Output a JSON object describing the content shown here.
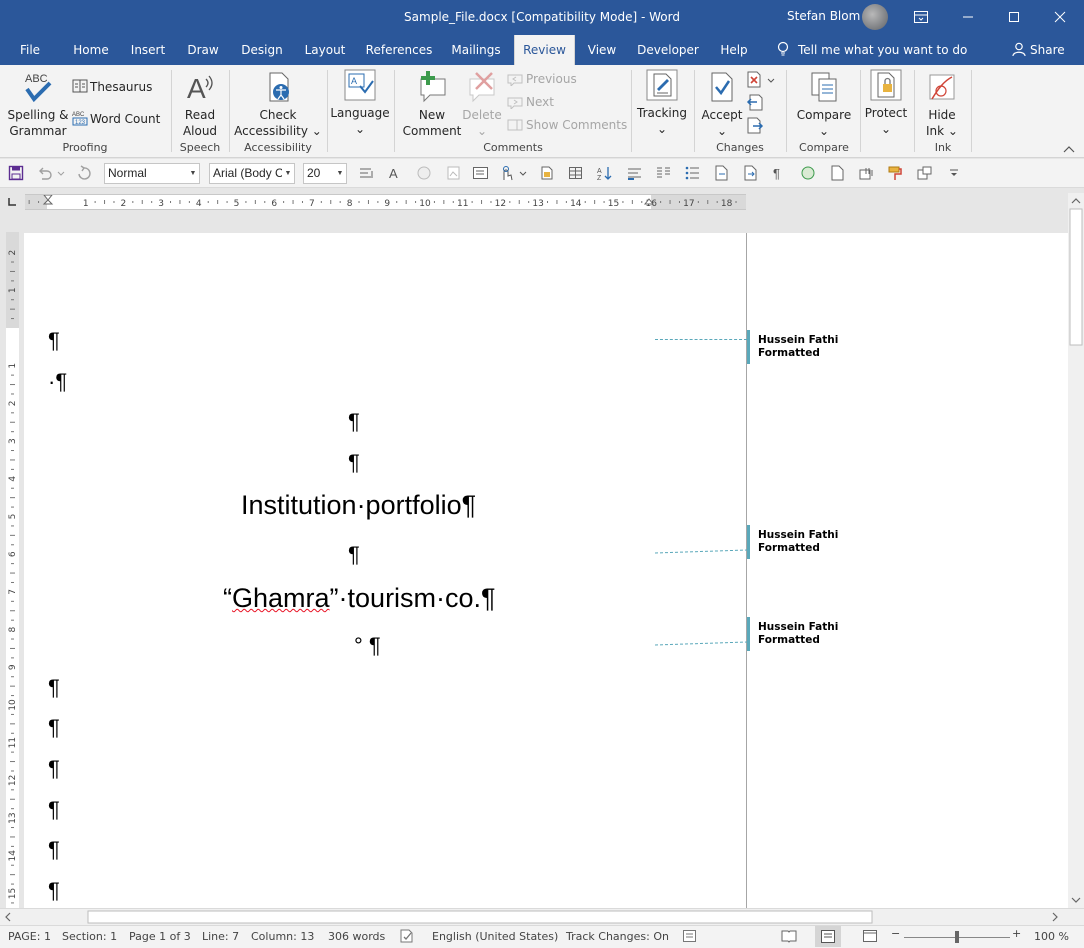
{
  "titlebar": {
    "title": "Sample_File.docx [Compatibility Mode]  -  Word",
    "user": "Stefan Blom",
    "window_buttons": [
      "ribbon-display-icon",
      "minimize-icon",
      "maximize-icon",
      "close-icon"
    ]
  },
  "tabs": [
    {
      "label": "File"
    },
    {
      "label": "Home"
    },
    {
      "label": "Insert"
    },
    {
      "label": "Draw"
    },
    {
      "label": "Design"
    },
    {
      "label": "Layout"
    },
    {
      "label": "References"
    },
    {
      "label": "Mailings"
    },
    {
      "label": "Review",
      "active": true
    },
    {
      "label": "View"
    },
    {
      "label": "Developer"
    },
    {
      "label": "Help"
    }
  ],
  "tellme": "Tell me what you want to do",
  "share": "Share",
  "ribbon": {
    "proofing": {
      "spelling_1": "Spelling &",
      "spelling_2": "Grammar",
      "thesaurus": "Thesaurus",
      "word_count": "Word Count",
      "label": "Proofing"
    },
    "speech": {
      "read_1": "Read",
      "read_2": "Aloud",
      "label": "Speech"
    },
    "accessibility": {
      "check_1": "Check",
      "check_2": "Accessibility ⌄",
      "label": "Accessibility"
    },
    "language": {
      "label_btn": "Language",
      "caret": "⌄"
    },
    "comments": {
      "new_1": "New",
      "new_2": "Comment",
      "delete_1": "Delete",
      "delete_2": "⌄",
      "previous": "Previous",
      "next": "Next",
      "show": "Show Comments",
      "label": "Comments"
    },
    "tracking": {
      "label_btn": "Tracking",
      "caret": "⌄"
    },
    "changes": {
      "accept": "Accept",
      "caret": "⌄",
      "label": "Changes"
    },
    "compare": {
      "label_btn": "Compare",
      "caret": "⌄",
      "label": "Compare"
    },
    "protect": {
      "label_btn": "Protect",
      "caret": "⌄"
    },
    "ink": {
      "hide_1": "Hide",
      "hide_2": "Ink ⌄",
      "label": "Ink"
    }
  },
  "qat": {
    "style": "Normal",
    "font": "Arial (Body C",
    "size": "20"
  },
  "document": {
    "pilcrow": "¶",
    "dot_pilcrow": "·¶",
    "title_line": "Institution·portfolio¶",
    "company_quote_open": "“",
    "company_name": "Ghamra",
    "company_rest": "”·tourism·co.¶",
    "degree_line": "° ¶"
  },
  "comments": [
    {
      "author": "Hussein Fathi",
      "action": "Formatted"
    },
    {
      "author": "Hussein Fathi",
      "action": "Formatted"
    },
    {
      "author": "Hussein Fathi",
      "action": "Formatted"
    }
  ],
  "status": {
    "page": "PAGE: 1",
    "section": "Section: 1",
    "page_of": "Page 1 of 3",
    "line": "Line: 7",
    "column": "Column: 13",
    "words": "306 words",
    "language": "English (United States)",
    "track": "Track Changes: On",
    "zoom": "100 %",
    "zoom_level_percent": 100
  },
  "ruler": {
    "h_numbers": [
      "2",
      "1",
      "1",
      "2",
      "3",
      "4",
      "5",
      "6",
      "7",
      "8",
      "9",
      "10",
      "11",
      "12",
      "13",
      "14",
      "15",
      "16",
      "17",
      "18"
    ],
    "v_numbers": [
      "2",
      "1",
      "1",
      "2",
      "3",
      "4",
      "5",
      "6",
      "7",
      "8",
      "9",
      "10",
      "11",
      "12",
      "13",
      "14",
      "15"
    ]
  },
  "colors": {
    "accent": "#2b579a",
    "balloon": "#5aa8ba",
    "squiggle": "#e81123"
  }
}
